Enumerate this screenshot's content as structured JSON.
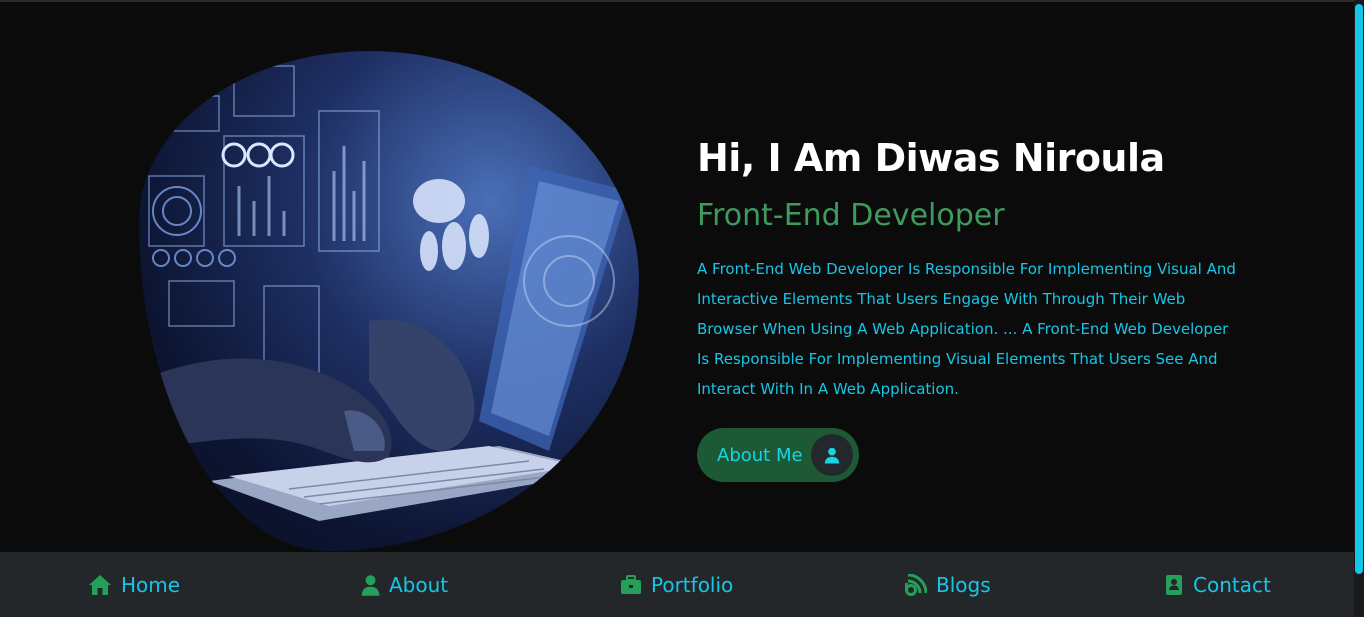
{
  "hero": {
    "title": "Hi, I Am Diwas Niroula",
    "subtitle": "Front-End Developer",
    "description": "A Front-End Web Developer Is Responsible For Implementing Visual And Interactive Elements That Users Engage With Through Their Web Browser When Using A Web Application. ... A Front-End Web Developer Is Responsible For Implementing Visual Elements That Users See And Interact With In A Web Application.",
    "button_label": "About Me",
    "button_icon": "user-icon"
  },
  "nav": {
    "items": [
      {
        "label": "Home",
        "icon": "home-icon"
      },
      {
        "label": "About",
        "icon": "user-icon"
      },
      {
        "label": "Portfolio",
        "icon": "briefcase-icon"
      },
      {
        "label": "Blogs",
        "icon": "blog-icon"
      },
      {
        "label": "Contact",
        "icon": "address-book-icon"
      }
    ]
  },
  "colors": {
    "background": "#0b0b0c",
    "navbar": "#24272a",
    "accent_cyan": "#16c6e6",
    "accent_green": "#3f9a5e",
    "button_green": "#1d5935",
    "icon_green": "#25a05a"
  }
}
